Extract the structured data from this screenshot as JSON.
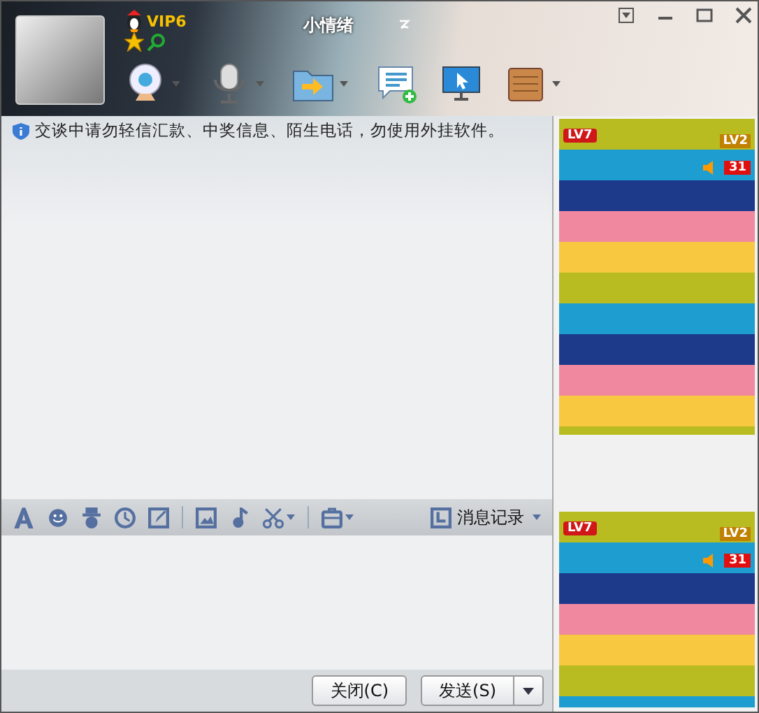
{
  "header": {
    "name": "小情绪",
    "vip": "VIP6"
  },
  "notice": "交谈中请勿轻信汇款、中奖信息、陌生电话，勿使用外挂软件。",
  "format_toolbar": {
    "history": "消息记录"
  },
  "buttons": {
    "close": "关闭(C)",
    "send": "发送(S)"
  },
  "shows": [
    {
      "rank": "LV7",
      "star_level": "LV2",
      "count": "31"
    },
    {
      "rank": "LV7",
      "star_level": "LV2",
      "count": "31"
    }
  ]
}
